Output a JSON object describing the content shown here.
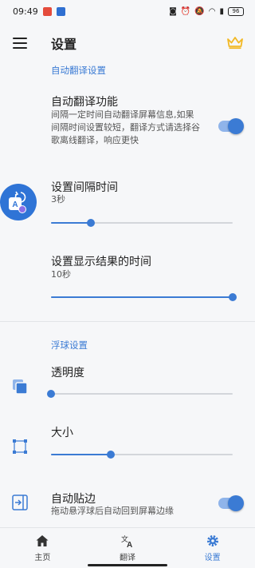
{
  "status_bar": {
    "time": "09:49",
    "battery": "96"
  },
  "header": {
    "title": "设置"
  },
  "auto_translate": {
    "section_label": "自动翻译设置",
    "toggle": {
      "title": "自动翻译功能",
      "description": "间隔一定时间自动翻译屏幕信息,如果间隔时间设置较短，翻译方式请选择谷歌离线翻译，响应更快",
      "enabled": true
    },
    "interval": {
      "title": "设置间隔时间",
      "value_label": "3秒",
      "level": 0.22
    },
    "display_time": {
      "title": "设置显示结果的时间",
      "value_label": "10秒",
      "level": 1.0
    }
  },
  "float_ball": {
    "section_label": "浮球设置",
    "opacity": {
      "title": "透明度",
      "level": 0.0
    },
    "size": {
      "title": "大小",
      "level": 0.33
    },
    "auto_snap": {
      "title": "自动贴边",
      "description": "拖动悬浮球后自动回到屏幕边缘",
      "enabled": true
    }
  },
  "bottom_nav": {
    "items": [
      {
        "label": "主页",
        "icon": "home-icon",
        "active": false
      },
      {
        "label": "翻译",
        "icon": "translate-icon",
        "active": false
      },
      {
        "label": "设置",
        "icon": "gear-icon",
        "active": true
      }
    ]
  },
  "colors": {
    "accent": "#3b7bd4",
    "accent_light": "#8fb4ea",
    "crown": "#f2b824",
    "background": "#f6f7f9"
  }
}
